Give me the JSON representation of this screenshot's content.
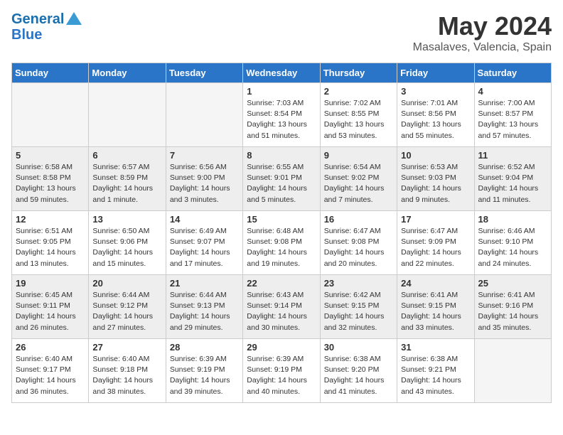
{
  "header": {
    "logo_line1": "General",
    "logo_line2": "Blue",
    "month_title": "May 2024",
    "location": "Masalaves, Valencia, Spain"
  },
  "days_of_week": [
    "Sunday",
    "Monday",
    "Tuesday",
    "Wednesday",
    "Thursday",
    "Friday",
    "Saturday"
  ],
  "weeks": [
    [
      {
        "day": "",
        "sunrise": "",
        "sunset": "",
        "daylight": ""
      },
      {
        "day": "",
        "sunrise": "",
        "sunset": "",
        "daylight": ""
      },
      {
        "day": "",
        "sunrise": "",
        "sunset": "",
        "daylight": ""
      },
      {
        "day": "1",
        "sunrise": "Sunrise: 7:03 AM",
        "sunset": "Sunset: 8:54 PM",
        "daylight": "Daylight: 13 hours and 51 minutes."
      },
      {
        "day": "2",
        "sunrise": "Sunrise: 7:02 AM",
        "sunset": "Sunset: 8:55 PM",
        "daylight": "Daylight: 13 hours and 53 minutes."
      },
      {
        "day": "3",
        "sunrise": "Sunrise: 7:01 AM",
        "sunset": "Sunset: 8:56 PM",
        "daylight": "Daylight: 13 hours and 55 minutes."
      },
      {
        "day": "4",
        "sunrise": "Sunrise: 7:00 AM",
        "sunset": "Sunset: 8:57 PM",
        "daylight": "Daylight: 13 hours and 57 minutes."
      }
    ],
    [
      {
        "day": "5",
        "sunrise": "Sunrise: 6:58 AM",
        "sunset": "Sunset: 8:58 PM",
        "daylight": "Daylight: 13 hours and 59 minutes."
      },
      {
        "day": "6",
        "sunrise": "Sunrise: 6:57 AM",
        "sunset": "Sunset: 8:59 PM",
        "daylight": "Daylight: 14 hours and 1 minute."
      },
      {
        "day": "7",
        "sunrise": "Sunrise: 6:56 AM",
        "sunset": "Sunset: 9:00 PM",
        "daylight": "Daylight: 14 hours and 3 minutes."
      },
      {
        "day": "8",
        "sunrise": "Sunrise: 6:55 AM",
        "sunset": "Sunset: 9:01 PM",
        "daylight": "Daylight: 14 hours and 5 minutes."
      },
      {
        "day": "9",
        "sunrise": "Sunrise: 6:54 AM",
        "sunset": "Sunset: 9:02 PM",
        "daylight": "Daylight: 14 hours and 7 minutes."
      },
      {
        "day": "10",
        "sunrise": "Sunrise: 6:53 AM",
        "sunset": "Sunset: 9:03 PM",
        "daylight": "Daylight: 14 hours and 9 minutes."
      },
      {
        "day": "11",
        "sunrise": "Sunrise: 6:52 AM",
        "sunset": "Sunset: 9:04 PM",
        "daylight": "Daylight: 14 hours and 11 minutes."
      }
    ],
    [
      {
        "day": "12",
        "sunrise": "Sunrise: 6:51 AM",
        "sunset": "Sunset: 9:05 PM",
        "daylight": "Daylight: 14 hours and 13 minutes."
      },
      {
        "day": "13",
        "sunrise": "Sunrise: 6:50 AM",
        "sunset": "Sunset: 9:06 PM",
        "daylight": "Daylight: 14 hours and 15 minutes."
      },
      {
        "day": "14",
        "sunrise": "Sunrise: 6:49 AM",
        "sunset": "Sunset: 9:07 PM",
        "daylight": "Daylight: 14 hours and 17 minutes."
      },
      {
        "day": "15",
        "sunrise": "Sunrise: 6:48 AM",
        "sunset": "Sunset: 9:08 PM",
        "daylight": "Daylight: 14 hours and 19 minutes."
      },
      {
        "day": "16",
        "sunrise": "Sunrise: 6:47 AM",
        "sunset": "Sunset: 9:08 PM",
        "daylight": "Daylight: 14 hours and 20 minutes."
      },
      {
        "day": "17",
        "sunrise": "Sunrise: 6:47 AM",
        "sunset": "Sunset: 9:09 PM",
        "daylight": "Daylight: 14 hours and 22 minutes."
      },
      {
        "day": "18",
        "sunrise": "Sunrise: 6:46 AM",
        "sunset": "Sunset: 9:10 PM",
        "daylight": "Daylight: 14 hours and 24 minutes."
      }
    ],
    [
      {
        "day": "19",
        "sunrise": "Sunrise: 6:45 AM",
        "sunset": "Sunset: 9:11 PM",
        "daylight": "Daylight: 14 hours and 26 minutes."
      },
      {
        "day": "20",
        "sunrise": "Sunrise: 6:44 AM",
        "sunset": "Sunset: 9:12 PM",
        "daylight": "Daylight: 14 hours and 27 minutes."
      },
      {
        "day": "21",
        "sunrise": "Sunrise: 6:44 AM",
        "sunset": "Sunset: 9:13 PM",
        "daylight": "Daylight: 14 hours and 29 minutes."
      },
      {
        "day": "22",
        "sunrise": "Sunrise: 6:43 AM",
        "sunset": "Sunset: 9:14 PM",
        "daylight": "Daylight: 14 hours and 30 minutes."
      },
      {
        "day": "23",
        "sunrise": "Sunrise: 6:42 AM",
        "sunset": "Sunset: 9:15 PM",
        "daylight": "Daylight: 14 hours and 32 minutes."
      },
      {
        "day": "24",
        "sunrise": "Sunrise: 6:41 AM",
        "sunset": "Sunset: 9:15 PM",
        "daylight": "Daylight: 14 hours and 33 minutes."
      },
      {
        "day": "25",
        "sunrise": "Sunrise: 6:41 AM",
        "sunset": "Sunset: 9:16 PM",
        "daylight": "Daylight: 14 hours and 35 minutes."
      }
    ],
    [
      {
        "day": "26",
        "sunrise": "Sunrise: 6:40 AM",
        "sunset": "Sunset: 9:17 PM",
        "daylight": "Daylight: 14 hours and 36 minutes."
      },
      {
        "day": "27",
        "sunrise": "Sunrise: 6:40 AM",
        "sunset": "Sunset: 9:18 PM",
        "daylight": "Daylight: 14 hours and 38 minutes."
      },
      {
        "day": "28",
        "sunrise": "Sunrise: 6:39 AM",
        "sunset": "Sunset: 9:19 PM",
        "daylight": "Daylight: 14 hours and 39 minutes."
      },
      {
        "day": "29",
        "sunrise": "Sunrise: 6:39 AM",
        "sunset": "Sunset: 9:19 PM",
        "daylight": "Daylight: 14 hours and 40 minutes."
      },
      {
        "day": "30",
        "sunrise": "Sunrise: 6:38 AM",
        "sunset": "Sunset: 9:20 PM",
        "daylight": "Daylight: 14 hours and 41 minutes."
      },
      {
        "day": "31",
        "sunrise": "Sunrise: 6:38 AM",
        "sunset": "Sunset: 9:21 PM",
        "daylight": "Daylight: 14 hours and 43 minutes."
      },
      {
        "day": "",
        "sunrise": "",
        "sunset": "",
        "daylight": ""
      }
    ]
  ]
}
